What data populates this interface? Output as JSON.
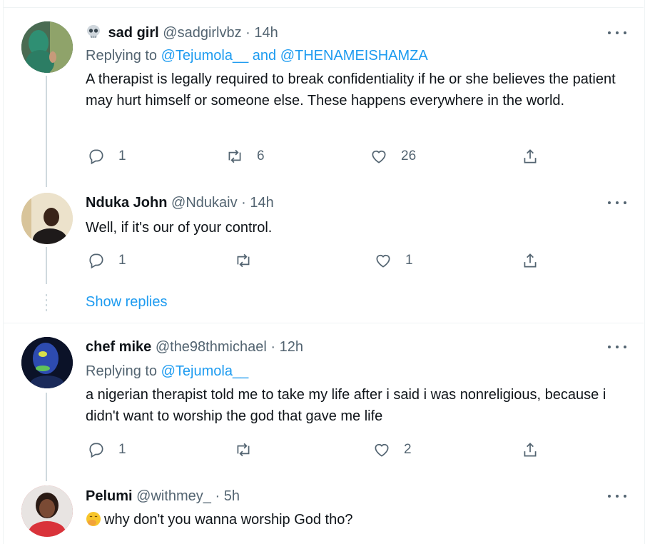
{
  "tweets": [
    {
      "emoji": "skull-emoji",
      "name": "sad girl",
      "handle": "@sadgirlvbz",
      "time": "14h",
      "replying_prefix": "Replying to",
      "replying_users": [
        "@Tejumola__",
        "and",
        "@THENAMEISHAMZA"
      ],
      "text": "A therapist is legally required to break confidentiality if he or she believes the patient may hurt himself or someone else. These happens everywhere in the world.",
      "replies": "1",
      "retweets": "6",
      "likes": "26"
    },
    {
      "name": "Nduka John",
      "handle": "@Ndukaiv",
      "time": "14h",
      "text": "Well, if it's our of your control.",
      "replies": "1",
      "retweets": "",
      "likes": "1"
    },
    {
      "name": "chef mike",
      "handle": "@the98thmichael",
      "time": "12h",
      "replying_prefix": "Replying to",
      "replying_users": [
        "@Tejumola__"
      ],
      "text": "a nigerian therapist told me to take my life after i said i was nonreligious, because i didn't want to worship the god that gave me life",
      "replies": "1",
      "retweets": "",
      "likes": "2"
    },
    {
      "name": "Pelumi",
      "handle": "@withmey_",
      "time": "5h",
      "emoji": "hand-over-mouth-emoji",
      "text": "why don't you wanna worship God tho?"
    }
  ],
  "show_replies": "Show replies",
  "separator": "·",
  "colors": {
    "link": "#1d9bf0",
    "secondary": "#536471",
    "border": "#eff3f4"
  }
}
